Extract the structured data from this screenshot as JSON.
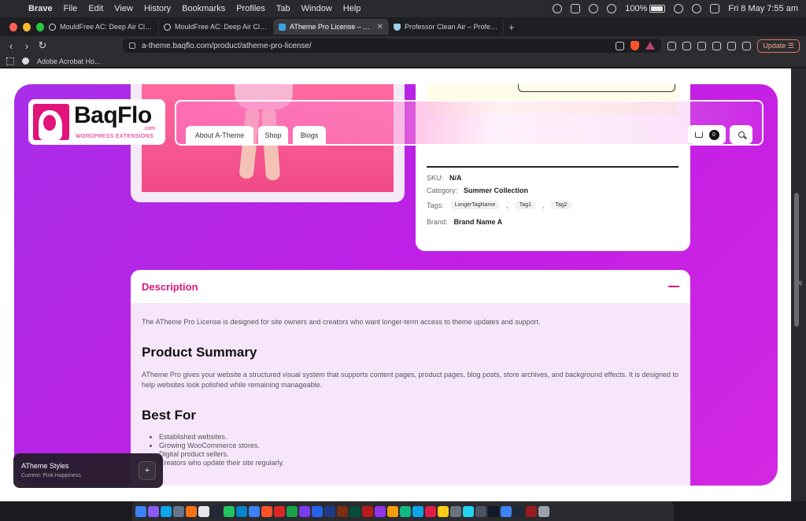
{
  "menubar": {
    "app": "Brave",
    "items": [
      "File",
      "Edit",
      "View",
      "History",
      "Bookmarks",
      "Profiles",
      "Tab",
      "Window",
      "Help"
    ],
    "battery": "100%",
    "datetime": "Fri 8 May  7:55 am"
  },
  "tabs": [
    {
      "label": "MouldFree AC: Deep Air Cleaning"
    },
    {
      "label": "MouldFree AC: Deep Air Cleaning"
    },
    {
      "label": "ATheme Pro License – A-Theme"
    },
    {
      "label": "Professor Clean Air – Professor Clean"
    }
  ],
  "toolbar": {
    "url": "a-theme.baqflo.com/product/atheme-pro-license/",
    "update_label": "Update"
  },
  "bookmarks": {
    "item": "Adobe Acrobat Ho..."
  },
  "logo": {
    "word": "BaqFlo",
    "com": ".com",
    "sub": "WORDPRESS EXTENSIONS"
  },
  "nav": {
    "about": "About A-Theme",
    "shop": "Shop",
    "blogs": "Blogs",
    "cart_count": "0"
  },
  "product": {
    "sku_label": "SKU:",
    "sku": "N/A",
    "category_label": "Category:",
    "category": "Summer Collection",
    "tags_label": "Tags:",
    "tags": [
      "LongerTagName",
      "Tag1",
      "Tag2"
    ],
    "brand_label": "Brand:",
    "brand": "Brand Name A"
  },
  "description": {
    "title": "Description",
    "intro": "The ATheme Pro License is designed for site owners and creators who want longer-term access to theme updates and support.",
    "h_summary": "Product Summary",
    "summary": "ATheme Pro gives your website a structured visual system that supports content pages, product pages, blog posts, store archives, and background effects. It is designed to help websites look polished while remaining manageable.",
    "h_bestfor": "Best For",
    "bestfor": [
      "Established websites.",
      "Growing WooCommerce stores.",
      "Digital product sellers.",
      "Creators who update their site regularly."
    ]
  },
  "styles_widget": {
    "title": "ATheme Styles",
    "subtitle": "Current: Pink Happiness",
    "add": "+"
  },
  "colors": {
    "accent": "#e0147a",
    "hero": "#c21ee5"
  }
}
